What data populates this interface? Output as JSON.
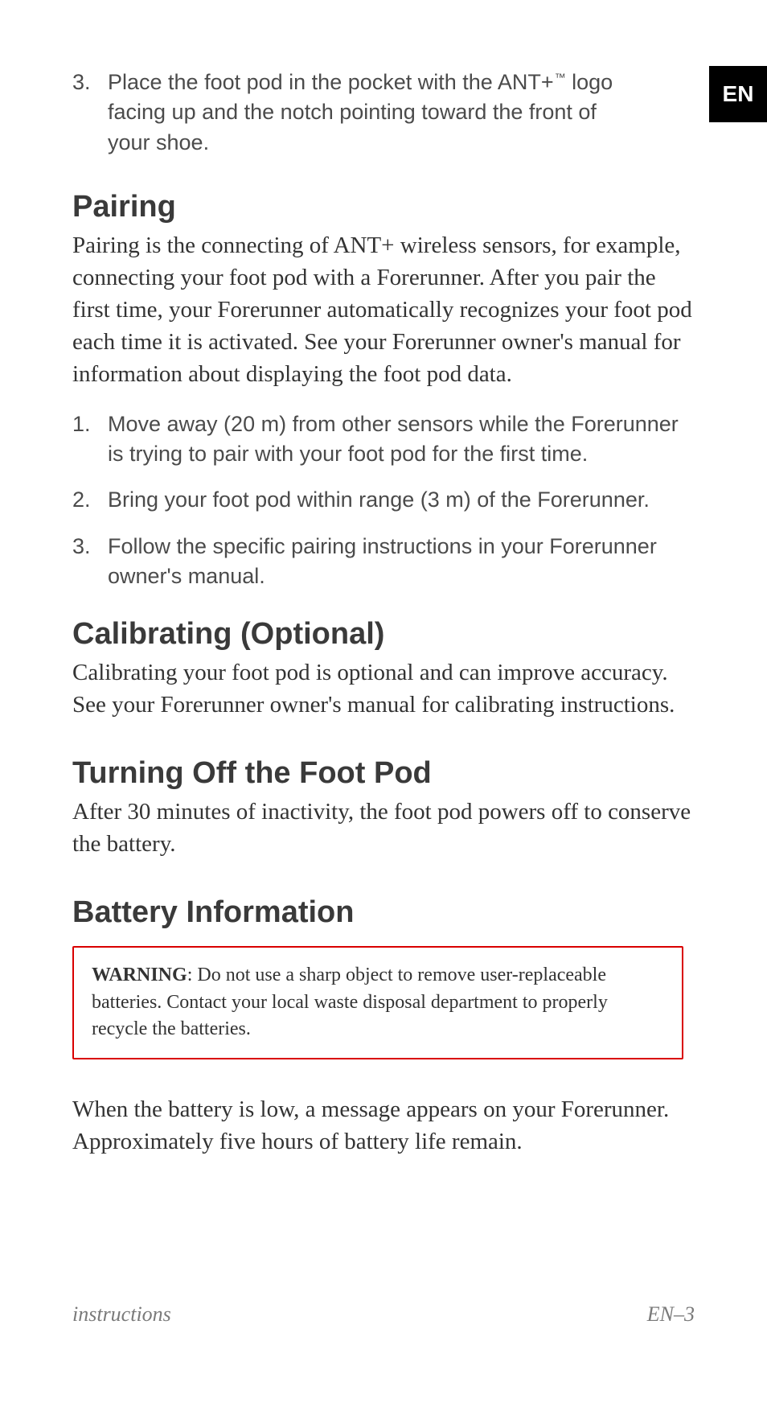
{
  "langTab": "EN",
  "topList": {
    "num": "3.",
    "text_a": "Place the foot pod in the pocket with the ANT+",
    "tm": "™",
    "text_b": " logo facing up and the notch pointing toward the front of your shoe."
  },
  "pairing": {
    "heading": "Pairing",
    "body": "Pairing is the connecting of ANT+ wireless sensors, for example, connecting your foot pod with a Forerunner. After you pair the first time, your Forerunner automatically recognizes your foot pod each time it is activated. See your Forerunner owner's manual for information about displaying the foot pod data.",
    "steps": [
      {
        "num": "1.",
        "text": "Move away (20 m) from other sensors while the Forerunner is trying to pair with your foot pod for the first time."
      },
      {
        "num": "2.",
        "text": "Bring your foot pod within range (3 m) of the Forerunner."
      },
      {
        "num": "3.",
        "text": "Follow the specific pairing instructions in your Forerunner owner's manual."
      }
    ]
  },
  "calibrating": {
    "heading": "Calibrating (Optional)",
    "body": "Calibrating your foot pod is optional and can improve accuracy. See your Forerunner owner's manual for calibrating instructions."
  },
  "turningOff": {
    "heading": "Turning Off the Foot Pod",
    "body": "After 30 minutes of inactivity, the foot pod powers off to conserve the battery."
  },
  "battery": {
    "heading": "Battery Information",
    "warningLabel": "WARNING",
    "warningText": ": Do not use a sharp object to remove user-replaceable batteries. Contact your local waste disposal department to properly recycle the batteries.",
    "body": "When the battery is low, a message appears on your Forerunner. Approximately five hours of battery life remain."
  },
  "footer": {
    "left": "instructions",
    "right": "EN–3"
  }
}
